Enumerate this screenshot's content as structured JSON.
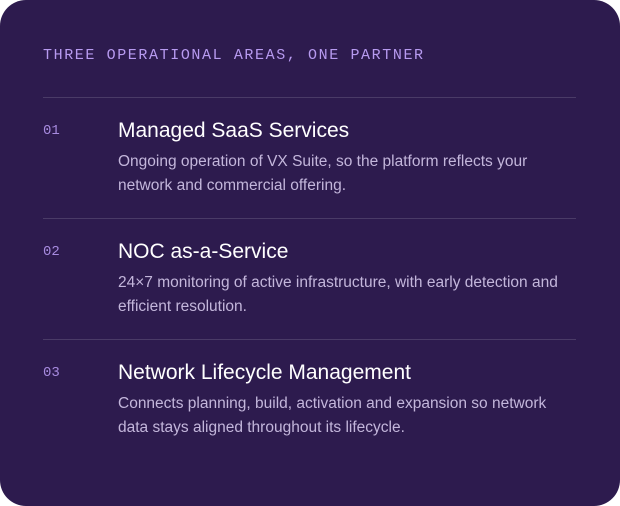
{
  "eyebrow": "THREE OPERATIONAL AREAS, ONE PARTNER",
  "items": [
    {
      "number": "01",
      "title": "Managed SaaS Services",
      "description": "Ongoing operation of VX Suite, so the platform reflects your network and commercial offering."
    },
    {
      "number": "02",
      "title": "NOC as-a-Service",
      "description": "24×7 monitoring of active infrastructure, with early detection and efficient resolution."
    },
    {
      "number": "03",
      "title": "Network Lifecycle Management",
      "description": "Connects planning, build, activation and expansion so network data stays aligned throughout its lifecycle."
    }
  ],
  "colors": {
    "background": "#2d1b4e",
    "accent": "#b79af0",
    "title": "#ffffff",
    "body_text": "#c3b6db"
  }
}
